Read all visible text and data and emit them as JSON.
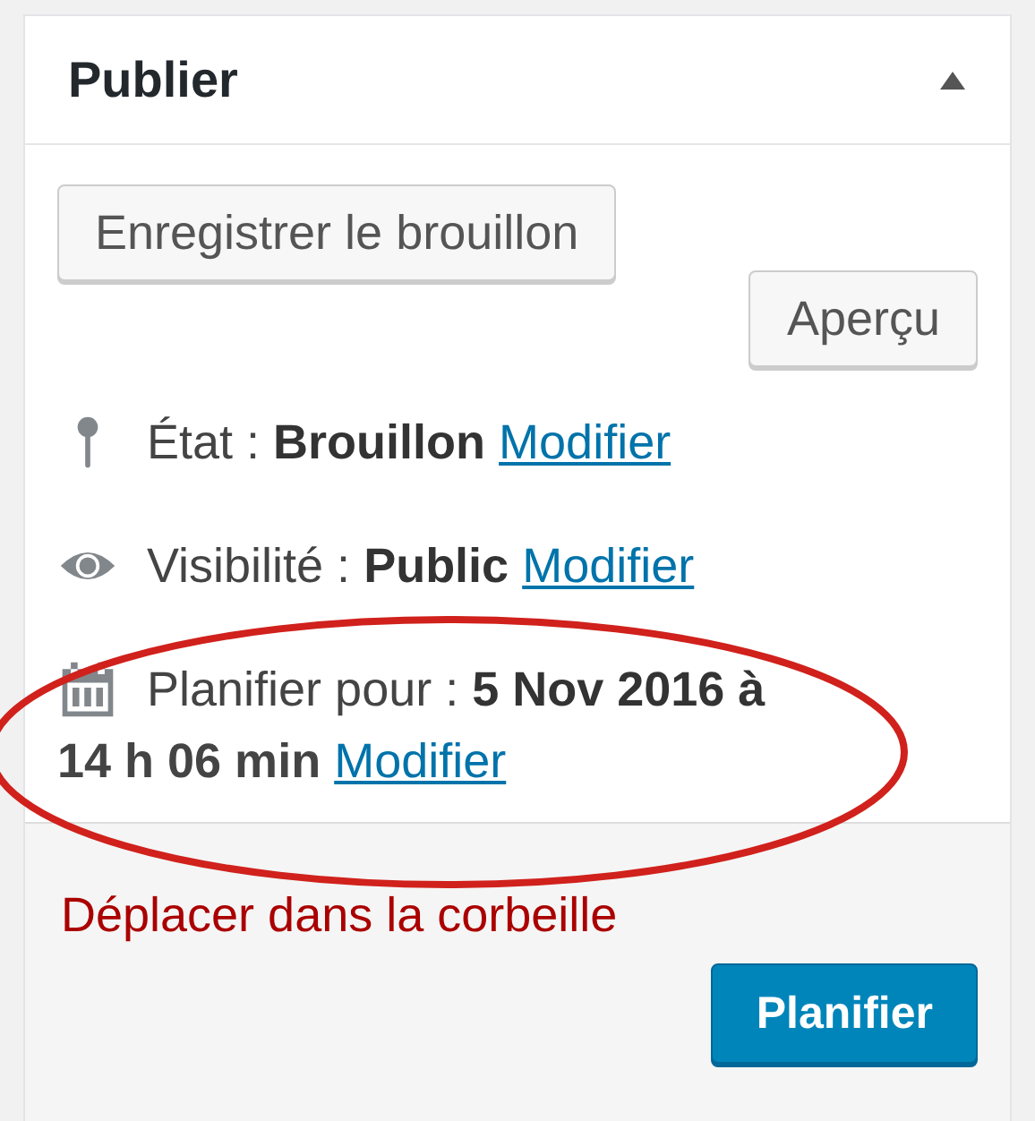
{
  "panel": {
    "title": "Publier",
    "expanded": true
  },
  "actions": {
    "save_draft": "Enregistrer le brouillon",
    "preview": "Aperçu"
  },
  "meta": [
    {
      "kind": "status",
      "text": "État : **Brouillon**",
      "link": "Modifier"
    },
    {
      "kind": "visibility",
      "text": "Visibilité : **Public**",
      "link": "Modifier"
    },
    {
      "kind": "schedule",
      "text": "Planifier pour : **5 Nov 2016 à**",
      "text_continued": "14 h 06 min",
      "link": "Modifier"
    }
  ],
  "footer": {
    "trash": "Déplacer dans la corbeille",
    "publish": "Planifier"
  }
}
